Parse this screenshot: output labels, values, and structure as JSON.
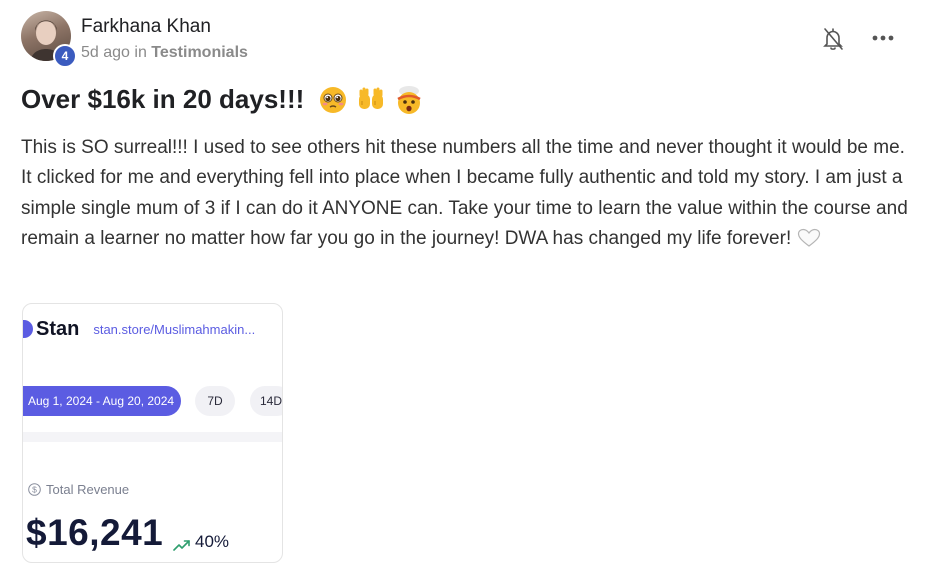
{
  "post": {
    "author": "Farkhana Khan",
    "level": "4",
    "time": "5d ago",
    "in_word": "in",
    "category": "Testimonials",
    "title": "Over $16k in 20 days!!!",
    "body": "This is SO surreal!!! I used to see others hit these numbers all the time and never thought it would be me. It clicked for me and everything fell into place when I became fully authentic and told my story. I am just a simple single mum of 3 if I can do it ANYONE can. Take your time to learn the value within the course and remain a learner no matter how far you go in the journey! DWA has changed my life forever!"
  },
  "icons": {
    "bell": "bell-off-icon",
    "more": "more-horizontal-icon",
    "heart": "white-heart-icon",
    "emojis": [
      "pleading-face-emoji",
      "raising-hands-emoji",
      "exploding-head-emoji"
    ]
  },
  "screenshot": {
    "brand": "Stan",
    "url": "stan.store/Muslimahmakin...",
    "date_range": "Aug 1, 2024 - Aug 20, 2024",
    "filter_7d": "7D",
    "filter_14d": "14D",
    "revenue_label": "Total Revenue",
    "revenue_value": "$16,241",
    "revenue_change": "40%"
  },
  "colors": {
    "accent": "#5b5ce2",
    "badge": "#3b5bbf",
    "revenue": "#141a38",
    "trend": "#2e9e6e"
  }
}
